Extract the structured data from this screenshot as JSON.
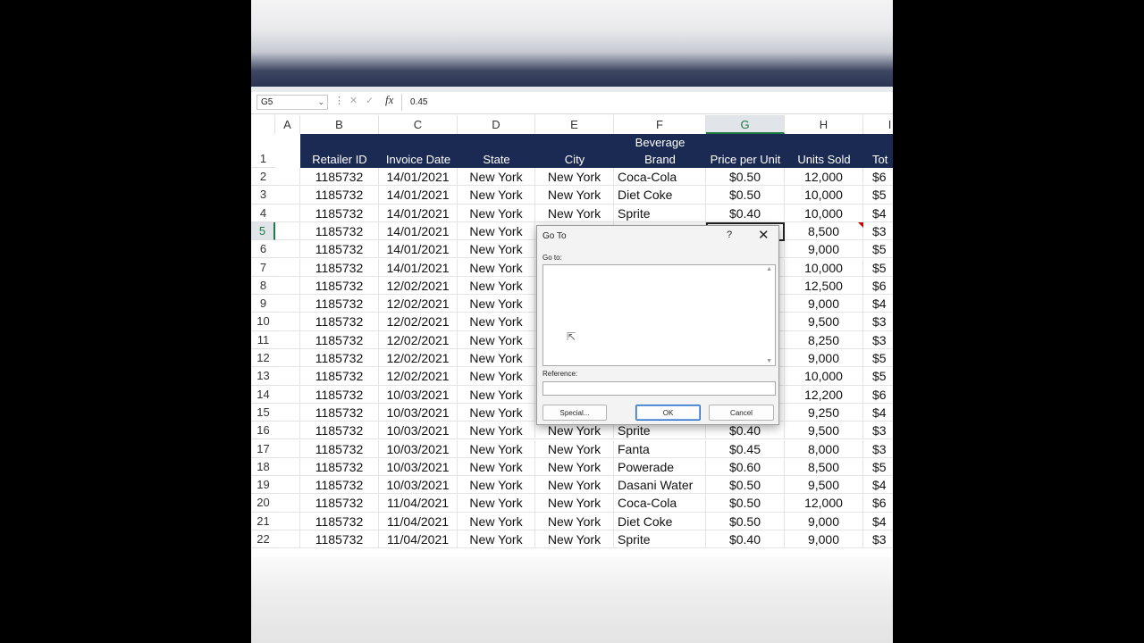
{
  "formula_bar": {
    "name_box": "G5",
    "value": "0.45",
    "fx_label": "fx",
    "cancel_glyph": "✕",
    "enter_glyph": "✓",
    "more_glyph": "⋮"
  },
  "columns": [
    "A",
    "B",
    "C",
    "D",
    "E",
    "F",
    "G",
    "H",
    "I"
  ],
  "selected_column": "G",
  "selected_row": 5,
  "header_row": {
    "row_number": "1",
    "cells": [
      "Retailer ID",
      "Invoice Date",
      "State",
      "City",
      "Beverage",
      "Brand",
      "Price per Unit",
      "Units Sold",
      "Tot"
    ]
  },
  "rows": [
    {
      "n": "2",
      "b": "1185732",
      "c": "14/01/2021",
      "d": "New York",
      "e": "New York",
      "f": "Coca-Cola",
      "g": "$0.50",
      "h": "12,000",
      "i": "$6"
    },
    {
      "n": "3",
      "b": "1185732",
      "c": "14/01/2021",
      "d": "New York",
      "e": "New York",
      "f": "Diet Coke",
      "g": "$0.50",
      "h": "10,000",
      "i": "$5"
    },
    {
      "n": "4",
      "b": "1185732",
      "c": "14/01/2021",
      "d": "New York",
      "e": "New York",
      "f": "Sprite",
      "g": "$0.40",
      "h": "10,000",
      "i": "$4"
    },
    {
      "n": "5",
      "b": "1185732",
      "c": "14/01/2021",
      "d": "New York",
      "e": "",
      "f": "",
      "g": "",
      "h": "8,500",
      "i": "$3"
    },
    {
      "n": "6",
      "b": "1185732",
      "c": "14/01/2021",
      "d": "New York",
      "e": "",
      "f": "",
      "g": "",
      "h": "9,000",
      "i": "$5"
    },
    {
      "n": "7",
      "b": "1185732",
      "c": "14/01/2021",
      "d": "New York",
      "e": "",
      "f": "",
      "g": "",
      "h": "10,000",
      "i": "$5"
    },
    {
      "n": "8",
      "b": "1185732",
      "c": "12/02/2021",
      "d": "New York",
      "e": "",
      "f": "",
      "g": "",
      "h": "12,500",
      "i": "$6"
    },
    {
      "n": "9",
      "b": "1185732",
      "c": "12/02/2021",
      "d": "New York",
      "e": "",
      "f": "",
      "g": "",
      "h": "9,000",
      "i": "$4"
    },
    {
      "n": "10",
      "b": "1185732",
      "c": "12/02/2021",
      "d": "New York",
      "e": "",
      "f": "",
      "g": "",
      "h": "9,500",
      "i": "$3"
    },
    {
      "n": "11",
      "b": "1185732",
      "c": "12/02/2021",
      "d": "New York",
      "e": "",
      "f": "",
      "g": "",
      "h": "8,250",
      "i": "$3"
    },
    {
      "n": "12",
      "b": "1185732",
      "c": "12/02/2021",
      "d": "New York",
      "e": "",
      "f": "",
      "g": "",
      "h": "9,000",
      "i": "$5"
    },
    {
      "n": "13",
      "b": "1185732",
      "c": "12/02/2021",
      "d": "New York",
      "e": "",
      "f": "",
      "g": "",
      "h": "10,000",
      "i": "$5"
    },
    {
      "n": "14",
      "b": "1185732",
      "c": "10/03/2021",
      "d": "New York",
      "e": "",
      "f": "",
      "g": "",
      "h": "12,200",
      "i": "$6"
    },
    {
      "n": "15",
      "b": "1185732",
      "c": "10/03/2021",
      "d": "New York",
      "e": "",
      "f": "",
      "g": "",
      "h": "9,250",
      "i": "$4"
    },
    {
      "n": "16",
      "b": "1185732",
      "c": "10/03/2021",
      "d": "New York",
      "e": "New York",
      "f": "Sprite",
      "g": "$0.40",
      "h": "9,500",
      "i": "$3"
    },
    {
      "n": "17",
      "b": "1185732",
      "c": "10/03/2021",
      "d": "New York",
      "e": "New York",
      "f": "Fanta",
      "g": "$0.45",
      "h": "8,000",
      "i": "$3"
    },
    {
      "n": "18",
      "b": "1185732",
      "c": "10/03/2021",
      "d": "New York",
      "e": "New York",
      "f": "Powerade",
      "g": "$0.60",
      "h": "8,500",
      "i": "$5"
    },
    {
      "n": "19",
      "b": "1185732",
      "c": "10/03/2021",
      "d": "New York",
      "e": "New York",
      "f": "Dasani Water",
      "g": "$0.50",
      "h": "9,500",
      "i": "$4"
    },
    {
      "n": "20",
      "b": "1185732",
      "c": "11/04/2021",
      "d": "New York",
      "e": "New York",
      "f": "Coca-Cola",
      "g": "$0.50",
      "h": "12,000",
      "i": "$6"
    },
    {
      "n": "21",
      "b": "1185732",
      "c": "11/04/2021",
      "d": "New York",
      "e": "New York",
      "f": "Diet Coke",
      "g": "$0.50",
      "h": "9,000",
      "i": "$4"
    },
    {
      "n": "22",
      "b": "1185732",
      "c": "11/04/2021",
      "d": "New York",
      "e": "New York",
      "f": "Sprite",
      "g": "$0.40",
      "h": "9,000",
      "i": "$3"
    }
  ],
  "dialog": {
    "title": "Go To",
    "help_glyph": "?",
    "close_glyph": "✕",
    "goto_label": "Go to:",
    "reference_label": "Reference:",
    "reference_value": "",
    "special_button": "Special...",
    "ok_button": "OK",
    "cancel_button": "Cancel"
  },
  "colors": {
    "header_fill": "#1b2a52",
    "selection_accent": "#1f7a44"
  }
}
